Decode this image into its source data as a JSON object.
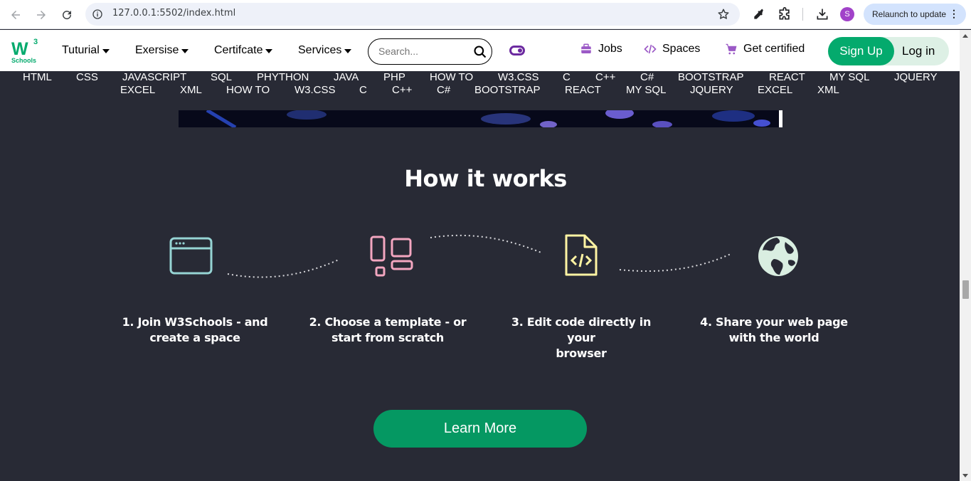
{
  "browser": {
    "url": "127.0.0.1:5502/index.html",
    "profile_initial": "S",
    "relaunch_label": "Relaunch to update"
  },
  "site": {
    "logo": {
      "text": "W",
      "superscript": "3",
      "subtitle": "Schools"
    },
    "menu": [
      "Tuturial",
      "Exersise",
      "Certifcate",
      "Services"
    ],
    "search_placeholder": "Search...",
    "links": {
      "jobs": "Jobs",
      "spaces": "Spaces",
      "certified": "Get certified"
    },
    "signup": "Sign Up",
    "login": "Log in"
  },
  "subnav": {
    "row1": [
      "HTML",
      "CSS",
      "JAVASCRIPT",
      "SQL",
      "PHYTHON",
      "JAVA",
      "PHP",
      "HOW TO",
      "W3.CSS",
      "C",
      "C++",
      "C#",
      "BOOTSTRAP",
      "REACT",
      "MY SQL",
      "JQUERY"
    ],
    "row2": [
      "EXCEL",
      "XML",
      "HOW TO",
      "W3.CSS",
      "C",
      "C++",
      "C#",
      "BOOTSTRAP",
      "REACT",
      "MY SQL",
      "JQUERY",
      "EXCEL",
      "XML"
    ]
  },
  "how_it_works": {
    "title": "How it works",
    "steps": [
      {
        "line1": "1. Join W3Schools - and",
        "line2": "create a space",
        "icon": "browser-window-icon",
        "color": "#96d4d4"
      },
      {
        "line1": "2. Choose a template - or",
        "line2": "start from scratch",
        "icon": "layout-template-icon",
        "color": "#f3a6c0"
      },
      {
        "line1": "3. Edit code directly in your",
        "line2": "browser",
        "icon": "code-file-icon",
        "color": "#fff4a3"
      },
      {
        "line1": "4. Share your web page",
        "line2": "with the world",
        "icon": "globe-icon",
        "color": "#d9eee1"
      }
    ],
    "cta": "Learn More"
  },
  "colors": {
    "accent": "#04aa6d",
    "background": "#282a35",
    "purple": "#6c2aa0"
  }
}
